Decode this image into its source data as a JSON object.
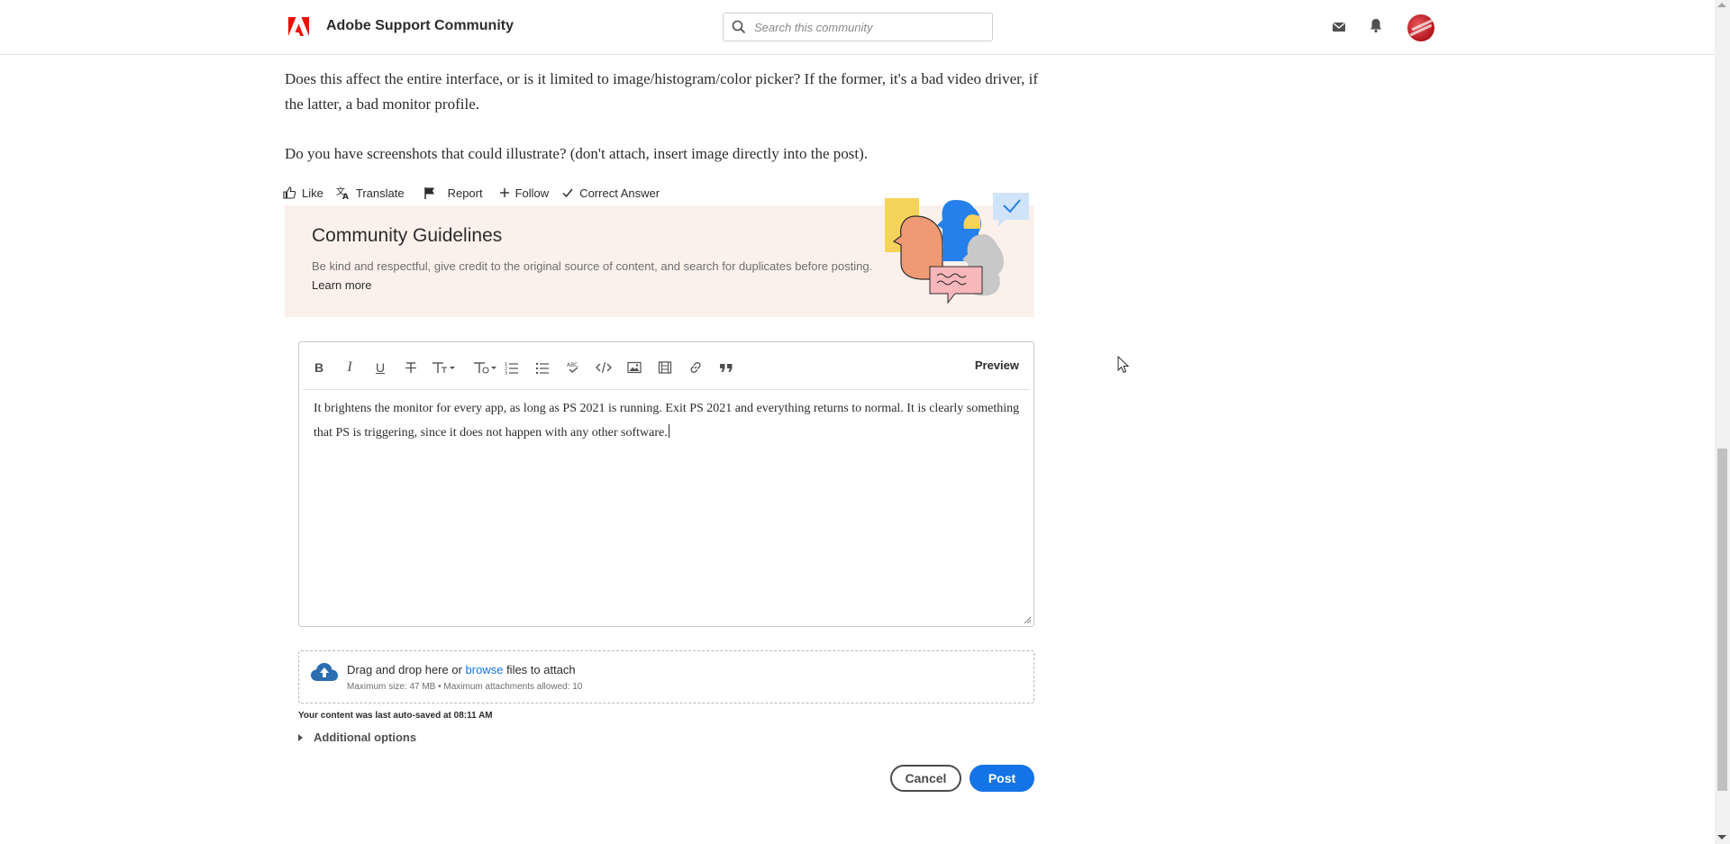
{
  "header": {
    "site_title": "Adobe Support Community",
    "search_placeholder": "Search this community"
  },
  "post": {
    "paragraph_1": "Does this affect the entire interface, or is it limited to image/histogram/color picker? If the former, it's a bad video driver, if the latter, a bad monitor profile.",
    "paragraph_2": "Do you have screenshots that could illustrate? (don't attach, insert image directly into the post).",
    "actions": {
      "like": "Like",
      "translate": "Translate",
      "report": "Report",
      "follow": "Follow",
      "correct_answer": "Correct Answer"
    }
  },
  "guidelines": {
    "title": "Community Guidelines",
    "description": "Be kind and respectful, give credit to the original source of content, and search for duplicates before posting.",
    "learn_more": "Learn more"
  },
  "editor": {
    "toolbar": {
      "bold": "B",
      "italic": "I",
      "underline": "U",
      "preview": "Preview"
    },
    "content": "It brightens the monitor for every app, as long as PS 2021 is running. Exit PS 2021 and everything returns to normal. It is clearly something that PS is triggering, since it does not happen with any other software."
  },
  "attachments": {
    "drag_prefix": "Drag and drop here or ",
    "browse": "browse",
    "drag_suffix": " files to attach",
    "limits": "Maximum size: 47 MB • Maximum attachments allowed: 10"
  },
  "autosave": "Your content was last auto-saved at 08:11 AM",
  "additional_options": "Additional options",
  "buttons": {
    "cancel": "Cancel",
    "post": "Post"
  },
  "colors": {
    "accent": "#1473e6",
    "banner_bg": "#fcf1ea",
    "adobe_red": "#eb1000"
  }
}
